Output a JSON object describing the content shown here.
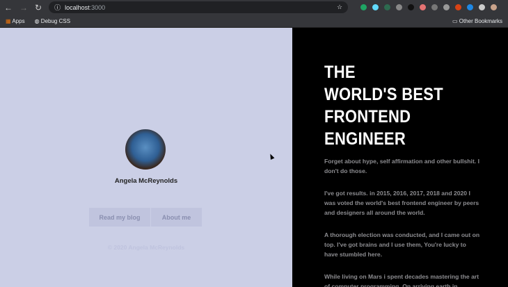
{
  "browser": {
    "url_host": "localhost",
    "url_port": ":3000",
    "bookmarks": [
      "Apps",
      "Debug CSS"
    ],
    "other_bookmarks": "Other Bookmarks"
  },
  "profile": {
    "name": "Angela McReynolds",
    "buttons": [
      "Read my blog",
      "About me"
    ],
    "copyright": "© 2020 Angela McReynolds"
  },
  "hero": {
    "title_lines": [
      "THE",
      "WORLD'S BEST",
      "FRONTEND",
      "ENGINEER"
    ],
    "paragraphs": [
      "Forget about hype, self affirmation and other bullshit. I don't do those.",
      "I've got results. in 2015, 2016, 2017, 2018 and 2020 I was voted the world's best frontend engineer by peers and designers all around the world.",
      "A thorough election was conducted, and I came out on top. I've got brains and I use them, You're lucky to have stumbled here.",
      "While living on Mars i spent decades mastering the art of computer programming. On arriving earth in"
    ]
  },
  "ext_colors": [
    "#1fa463",
    "#61dafb",
    "#2d6a4f",
    "#888",
    "#111",
    "#e57373",
    "#777",
    "#999",
    "#d84315",
    "#1e88e5",
    "#ccc"
  ]
}
